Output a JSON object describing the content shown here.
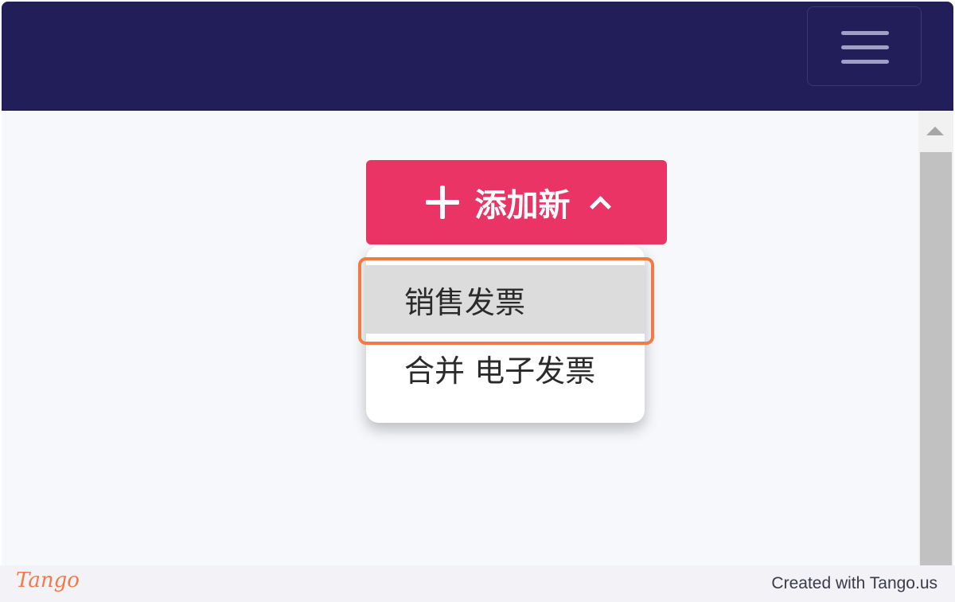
{
  "header": {
    "menu_icon": "hamburger-menu-icon"
  },
  "main": {
    "add_button": {
      "label": "添加新",
      "icon_left": "plus-icon",
      "icon_right": "chevron-up-icon",
      "color": "#ea3466"
    },
    "dropdown": {
      "items": [
        {
          "label": "销售发票",
          "hovered": true
        },
        {
          "label": "合并 电子发票",
          "hovered": false
        }
      ]
    },
    "highlight_color": "#f37b43"
  },
  "footer": {
    "logo": "Tango",
    "credit": "Created with Tango.us"
  },
  "colors": {
    "navbar": "#221e5a",
    "background": "#f7f8fc"
  }
}
